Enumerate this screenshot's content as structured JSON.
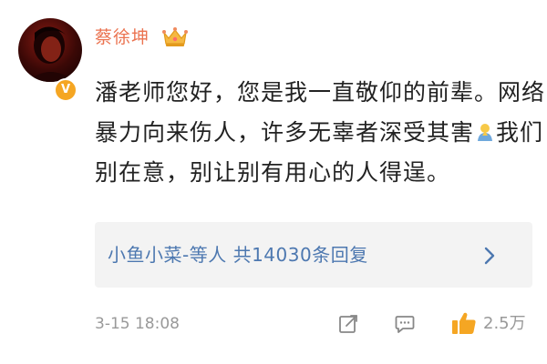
{
  "post": {
    "author": "蔡徐坤",
    "author_badge_icon": "crown-icon",
    "verified_badge": "V",
    "text_lines": [
      "潘老师您好，您是我一直敬仰的前辈。网络",
      "暴力向来伤人，许多无辜者深受其害",
      "别在意，别让别有用心的人得逞。"
    ],
    "line2_suffix": "我们",
    "inline_emoji_icon": "praying-hands-icon"
  },
  "replies": {
    "summary": "小鱼小菜-等人 共14030条回复",
    "icon": "chevron-right-icon"
  },
  "footer": {
    "timestamp": "3-15 18:08",
    "like_count": "2.5万"
  },
  "colors": {
    "username": "#eb7350",
    "link": "#4d78b0",
    "text": "#222222",
    "meta": "#999999",
    "replies_bg": "#f3f3f3",
    "verified": "#f5a623",
    "like": "#f5a623"
  }
}
